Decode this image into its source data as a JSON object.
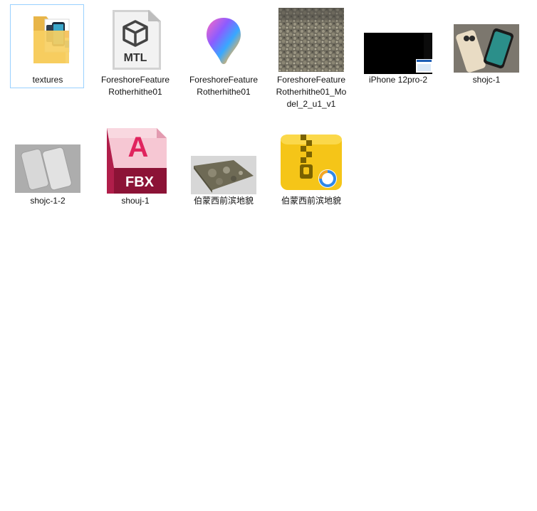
{
  "view": "large-icons",
  "accent": {
    "selection_border": "#99d1ff"
  },
  "items": [
    {
      "label": "textures",
      "type": "folder",
      "icon": "folder-with-phone-preview-icon",
      "selected": true
    },
    {
      "label": "ForeshoreFeatureRotherhithe01",
      "type": "mtl-file",
      "icon": "mtl-file-icon",
      "badge": "MTL"
    },
    {
      "label": "ForeshoreFeatureRotherhithe01",
      "type": "paint3d-file",
      "icon": "paint-3d-icon"
    },
    {
      "label": "ForeshoreFeatureRotherhithe01_Model_2_u1_v1",
      "type": "texture-image",
      "icon": "terrain-texture-thumbnail"
    },
    {
      "label": "iPhone 12pro-2",
      "type": "image",
      "icon": "dark-render-thumbnail"
    },
    {
      "label": "shojc-1",
      "type": "image",
      "icon": "phones-on-rock-thumbnail"
    },
    {
      "label": "shojc-1-2",
      "type": "image",
      "icon": "gray-phones-thumbnail"
    },
    {
      "label": "shouj-1",
      "type": "fbx-file",
      "icon": "autodesk-fbx-icon",
      "badge": "FBX",
      "logo_letter": "A"
    },
    {
      "label": "伯蒙西前滨地貌",
      "type": "image",
      "icon": "terrain-slab-thumbnail"
    },
    {
      "label": "伯蒙西前滨地貌",
      "type": "zip-archive",
      "icon": "zip-archive-icon"
    }
  ]
}
